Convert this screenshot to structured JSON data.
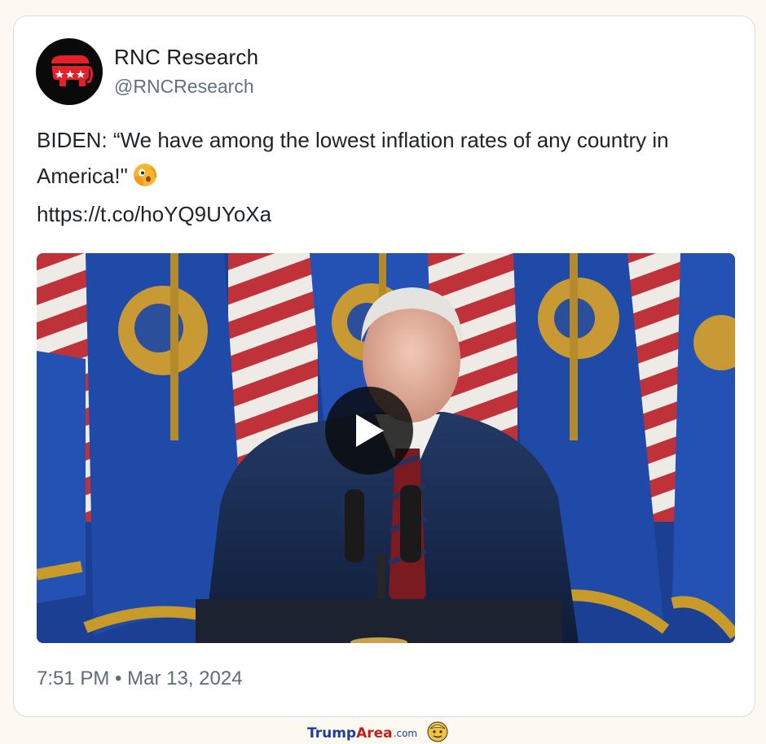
{
  "tweet": {
    "display_name": "RNC Research",
    "handle": "@RNCResearch",
    "text": "BIDEN: “We have among the lowest inflation rates of any country in America!\"",
    "emoji": "face-with-peeking-eye-emoji",
    "link": "https://t.co/hoYQ9UYoXa",
    "timestamp": "7:51 PM • Mar 13, 2024"
  },
  "avatar": {
    "icon": "republican-elephant-icon",
    "background": "#0a0a0a",
    "accent": "#e4212a"
  },
  "media": {
    "type": "video",
    "play_icon": "play-icon"
  },
  "watermark": {
    "part1": "Trump",
    "part2": "Area",
    "part3": ".com"
  },
  "colors": {
    "page_background": "#fdf9f1",
    "card_background": "#ffffff",
    "card_border": "#d9dde1",
    "handle": "#64707a",
    "text": "#1f2328"
  }
}
